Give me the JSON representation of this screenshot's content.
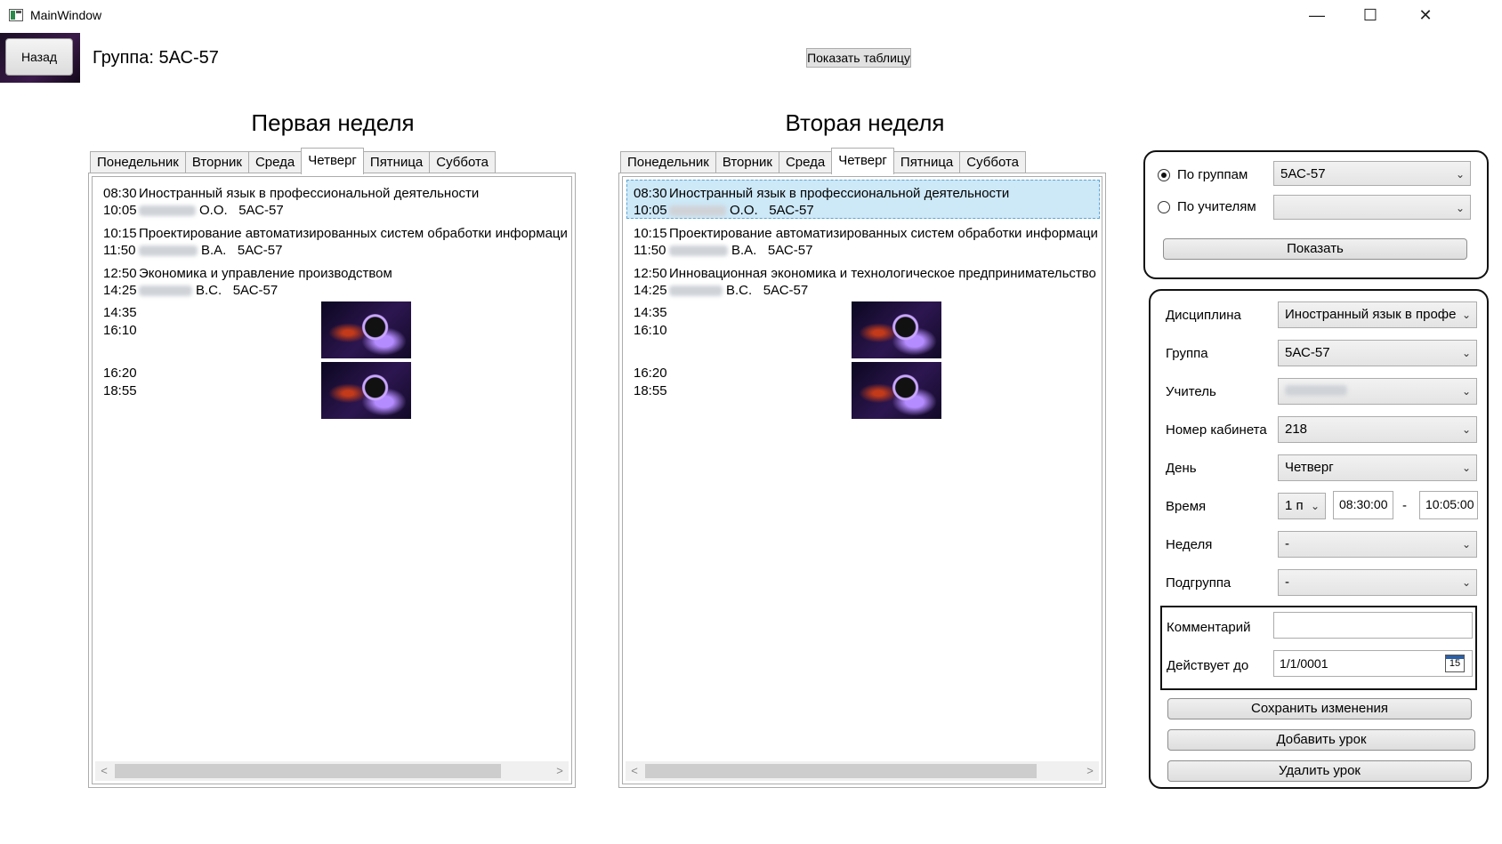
{
  "window": {
    "title": "MainWindow",
    "minimize": "—",
    "maximize": "☐",
    "close": "✕"
  },
  "header": {
    "back_label": "Назад",
    "group_label": "Группа: 5АС-57",
    "show_table_label": "Показать таблицу"
  },
  "weeks": [
    {
      "title": "Первая неделя",
      "tabs": [
        "Понедельник",
        "Вторник",
        "Среда",
        "Четверг",
        "Пятница",
        "Суббота"
      ],
      "active_tab": "Четверг",
      "lessons": [
        {
          "start": "08:30",
          "end": "10:05",
          "subject": "Иностранный язык в профессиональной деятельности",
          "teacher": "О.О.",
          "group": "5АС-57"
        },
        {
          "start": "10:15",
          "end": "11:50",
          "subject": "Проектирование автоматизированных систем обработки информаци",
          "teacher": "В.А.",
          "group": "5АС-57"
        },
        {
          "start": "12:50",
          "end": "14:25",
          "subject": "Экономика и управление производством",
          "teacher": "В.С.",
          "group": "5АС-57"
        },
        {
          "start": "14:35",
          "end": "16:10"
        },
        {
          "start": "16:20",
          "end": "18:55"
        }
      ]
    },
    {
      "title": "Вторая неделя",
      "tabs": [
        "Понедельник",
        "Вторник",
        "Среда",
        "Четверг",
        "Пятница",
        "Суббота"
      ],
      "active_tab": "Четверг",
      "lessons": [
        {
          "start": "08:30",
          "end": "10:05",
          "subject": "Иностранный язык в профессиональной деятельности",
          "teacher": "О.О.",
          "group": "5АС-57"
        },
        {
          "start": "10:15",
          "end": "11:50",
          "subject": "Проектирование автоматизированных систем обработки информаци",
          "teacher": "В.А.",
          "group": "5АС-57"
        },
        {
          "start": "12:50",
          "end": "14:25",
          "subject": "Инновационная экономика и технологическое предпринимательство",
          "teacher": "В.С.",
          "group": "5АС-57"
        },
        {
          "start": "14:35",
          "end": "16:10"
        },
        {
          "start": "16:20",
          "end": "18:55"
        }
      ]
    }
  ],
  "filter": {
    "by_groups_label": "По группам",
    "by_groups_value": "5АС-57",
    "by_teachers_label": "По учителям",
    "by_teachers_value": "",
    "show_label": "Показать"
  },
  "editor": {
    "discipline_label": "Дисциплина",
    "discipline_value": "Иностранный язык в профе",
    "group_label": "Группа",
    "group_value": "5АС-57",
    "teacher_label": "Учитель",
    "teacher_value": "",
    "room_label": "Номер кабинета",
    "room_value": "218",
    "day_label": "День",
    "day_value": "Четверг",
    "time_label": "Время",
    "pair_value": "1 п",
    "time_start": "08:30:00",
    "time_dash": "-",
    "time_end": "10:05:00",
    "week_label": "Неделя",
    "week_value": "-",
    "subgroup_label": "Подгруппа",
    "subgroup_value": "-",
    "comment_label": "Комментарий",
    "comment_value": "",
    "valid_until_label": "Действует до",
    "valid_until_value": "1/1/0001",
    "calendar_day": "15",
    "save_label": "Сохранить изменения",
    "add_label": "Добавить урок",
    "delete_label": "Удалить урок"
  }
}
